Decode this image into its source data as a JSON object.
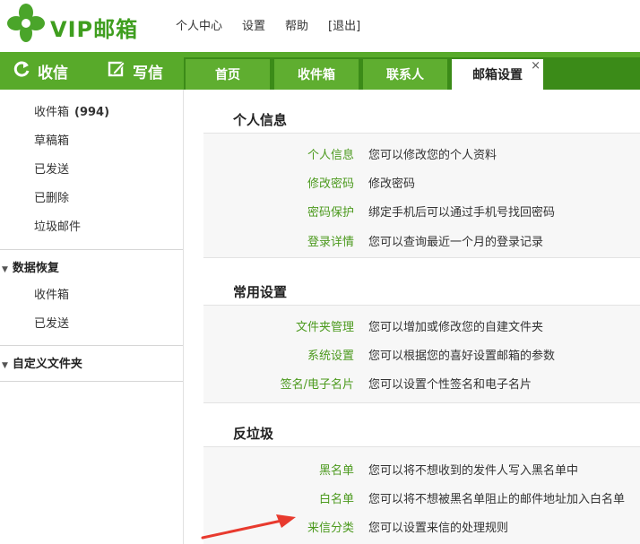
{
  "header": {
    "logo_text": "VIP邮箱",
    "nav": [
      "个人中心",
      "设置",
      "帮助",
      "[退出]"
    ]
  },
  "toolbar": {
    "receive_label": "收信",
    "write_label": "写信"
  },
  "tabs": [
    {
      "label": "首页"
    },
    {
      "label": "收件箱"
    },
    {
      "label": "联系人"
    },
    {
      "label": "邮箱设置",
      "close": "×"
    }
  ],
  "sidebar": {
    "folders": [
      {
        "label": "收件箱",
        "count": "(994)"
      },
      {
        "label": "草稿箱"
      },
      {
        "label": "已发送"
      },
      {
        "label": "已删除"
      },
      {
        "label": "垃圾邮件"
      }
    ],
    "recovery": {
      "title": "数据恢复",
      "items": [
        "收件箱",
        "已发送"
      ]
    },
    "custom_folders": {
      "title": "自定义文件夹"
    }
  },
  "sections": [
    {
      "title": "个人信息",
      "rows": [
        {
          "label": "个人信息",
          "desc": "您可以修改您的个人资料"
        },
        {
          "label": "修改密码",
          "desc": "修改密码"
        },
        {
          "label": "密码保护",
          "desc": "绑定手机后可以通过手机号找回密码"
        },
        {
          "label": "登录详情",
          "desc": "您可以查询最近一个月的登录记录"
        }
      ]
    },
    {
      "title": "常用设置",
      "rows": [
        {
          "label": "文件夹管理",
          "desc": "您可以增加或修改您的自建文件夹"
        },
        {
          "label": "系统设置",
          "desc": "您可以根据您的喜好设置邮箱的参数"
        },
        {
          "label": "签名/电子名片",
          "desc": "您可以设置个性签名和电子名片"
        }
      ]
    },
    {
      "title": "反垃圾",
      "rows": [
        {
          "label": "黑名单",
          "desc": "您可以将不想收到的发件人写入黑名单中"
        },
        {
          "label": "白名单",
          "desc": "您可以将不想被黑名单阻止的邮件地址加入白名单"
        },
        {
          "label": "来信分类",
          "desc": "您可以设置来信的处理规则"
        }
      ]
    }
  ],
  "colors": {
    "brand_green": "#58aa2a",
    "link_green": "#4c9a1e",
    "annotation_red": "#e83a2e"
  }
}
